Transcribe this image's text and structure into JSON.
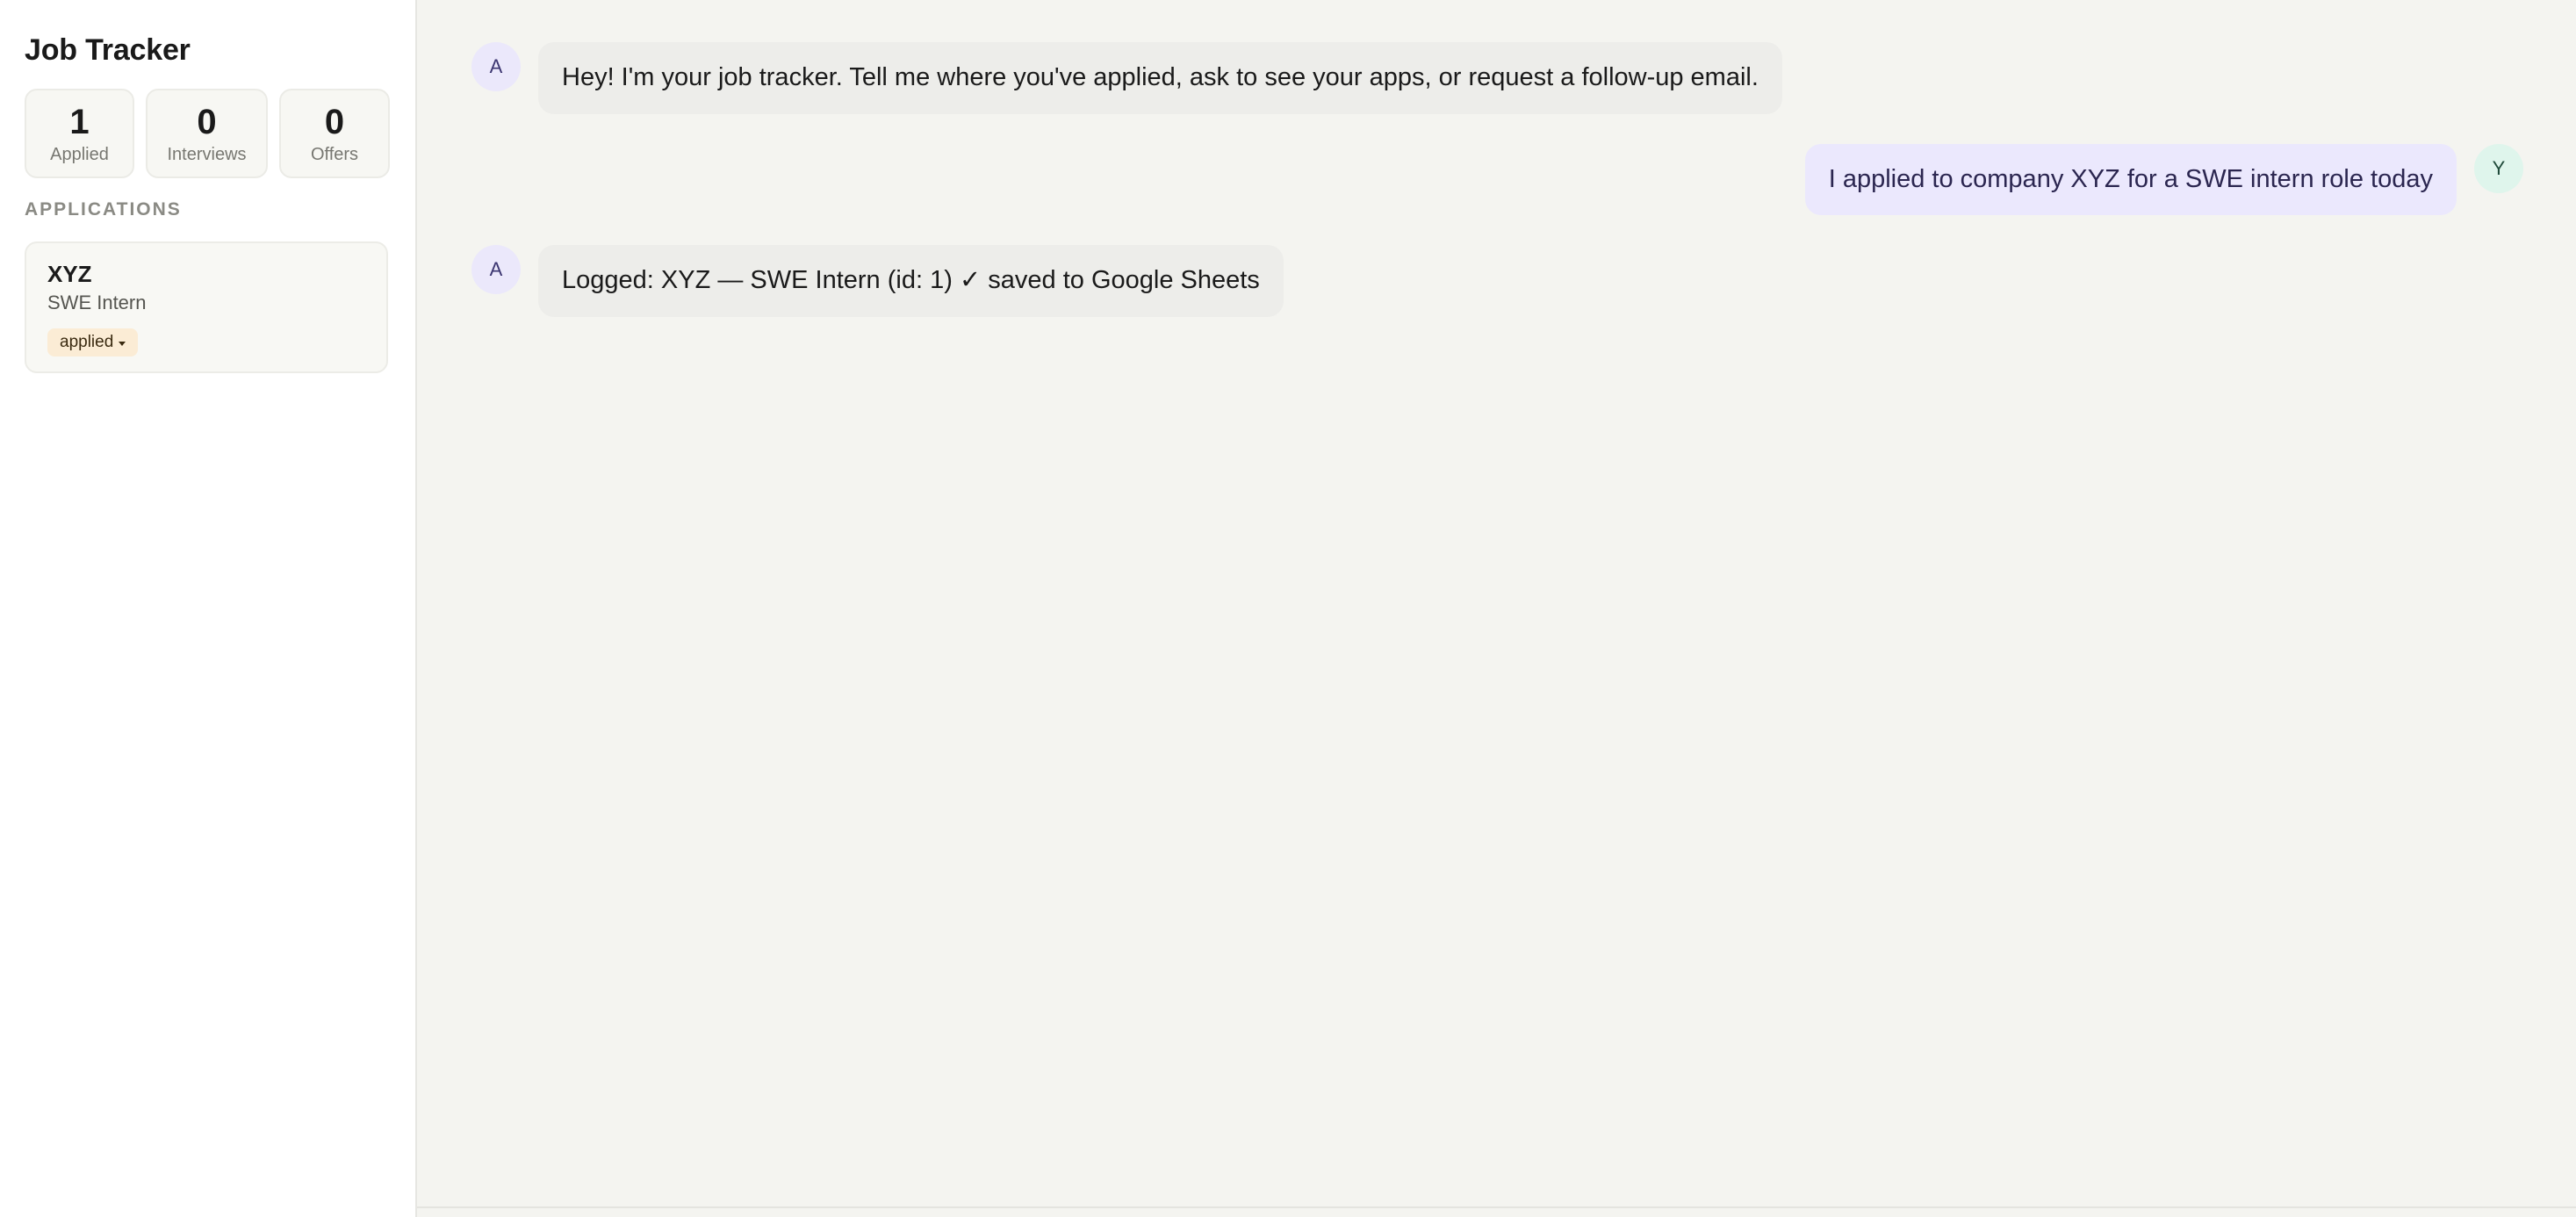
{
  "sidebar": {
    "title": "Job Tracker",
    "stats": [
      {
        "value": "1",
        "label": "Applied"
      },
      {
        "value": "0",
        "label": "Interviews"
      },
      {
        "value": "0",
        "label": "Offers"
      }
    ],
    "section_label": "APPLICATIONS",
    "applications": [
      {
        "company": "XYZ",
        "role": "SWE Intern",
        "status": "applied"
      }
    ]
  },
  "chat": {
    "messages": [
      {
        "sender": "assistant",
        "avatar": "A",
        "text": "Hey! I'm your job tracker. Tell me where you've applied, ask to see your apps, or request a follow-up email."
      },
      {
        "sender": "user",
        "avatar": "Y",
        "text": "I applied to company XYZ for a SWE intern role today"
      },
      {
        "sender": "assistant",
        "avatar": "A",
        "text": "Logged: XYZ — SWE Intern (id: 1) ✓ saved to Google Sheets"
      }
    ]
  },
  "colors": {
    "accent_assistant_bubble": "#ededea",
    "accent_user_bubble": "#ebe8fd",
    "status_applied": "#fbecd5",
    "background": "#f4f4f0"
  },
  "icons": {
    "status_dropdown": "caret-down-icon"
  }
}
